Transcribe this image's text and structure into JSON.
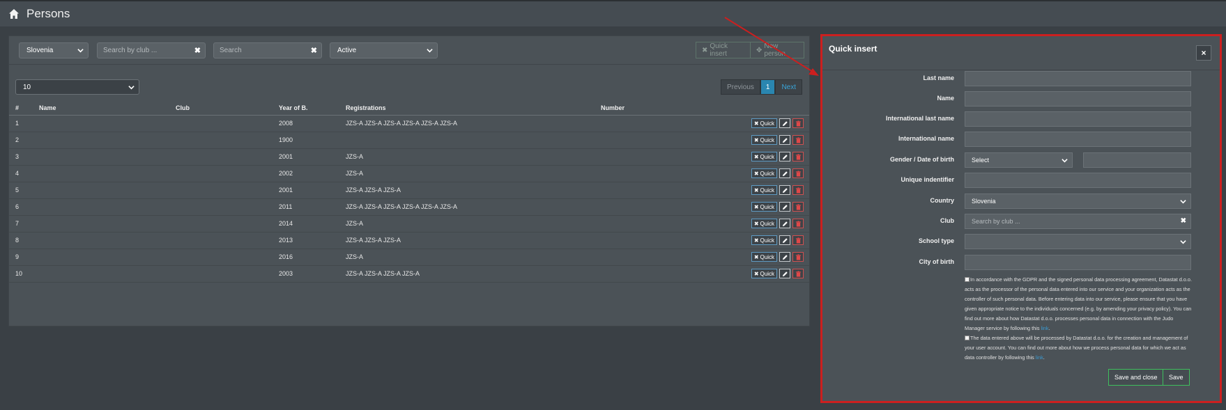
{
  "header": {
    "title": "Persons",
    "icon": "home-icon"
  },
  "filters": {
    "country": "Slovenia",
    "club_placeholder": "Search by club ...",
    "search_placeholder": "Search",
    "status": "Active",
    "quick_insert_label": "Quick insert",
    "new_person_label": "New person"
  },
  "pagination": {
    "page_size": "10",
    "previous": "Previous",
    "current": "1",
    "next": "Next"
  },
  "table": {
    "headers": [
      "#",
      "Name",
      "Club",
      "Year of B.",
      "Registrations",
      "Number"
    ],
    "quick_label": "Quick",
    "rows": [
      {
        "num": "1",
        "name": "",
        "club": "",
        "year": "2008",
        "registrations": "JZS-A JZS-A JZS-A JZS-A JZS-A JZS-A",
        "number": ""
      },
      {
        "num": "2",
        "name": "",
        "club": "",
        "year": "1900",
        "registrations": "",
        "number": ""
      },
      {
        "num": "3",
        "name": "",
        "club": "",
        "year": "2001",
        "registrations": "JZS-A",
        "number": ""
      },
      {
        "num": "4",
        "name": "",
        "club": "",
        "year": "2002",
        "registrations": "JZS-A",
        "number": ""
      },
      {
        "num": "5",
        "name": "",
        "club": "",
        "year": "2001",
        "registrations": "JZS-A JZS-A JZS-A",
        "number": ""
      },
      {
        "num": "6",
        "name": "",
        "club": "",
        "year": "2011",
        "registrations": "JZS-A JZS-A JZS-A JZS-A JZS-A JZS-A",
        "number": ""
      },
      {
        "num": "7",
        "name": "",
        "club": "",
        "year": "2014",
        "registrations": "JZS-A",
        "number": ""
      },
      {
        "num": "8",
        "name": "",
        "club": "",
        "year": "2013",
        "registrations": "JZS-A JZS-A JZS-A",
        "number": ""
      },
      {
        "num": "9",
        "name": "",
        "club": "",
        "year": "2016",
        "registrations": "JZS-A",
        "number": ""
      },
      {
        "num": "10",
        "name": "",
        "club": "",
        "year": "2003",
        "registrations": "JZS-A JZS-A JZS-A JZS-A",
        "number": ""
      }
    ]
  },
  "modal": {
    "title": "Quick insert",
    "close": "×",
    "fields": {
      "last_name": "Last name",
      "name": "Name",
      "intl_last_name": "International last name",
      "intl_name": "International name",
      "gender_dob": "Gender / Date of birth",
      "gender_value": "Select",
      "unique_id": "Unique indentifier",
      "country": "Country",
      "country_value": "Slovenia",
      "club": "Club",
      "club_placeholder": "Search by club ...",
      "school_type": "School type",
      "city_of_birth": "City of birth"
    },
    "consent1": "In accordance with the GDPR and the signed personal data processing agreement, Datastat d.o.o. acts as the processor of the personal data entered into our service and your organization acts as the controller of such personal data. Before entering data into our service, please ensure that you have given appropriate notice to the individuals concerned (e.g. by amending your privacy policy). You can find out more about how Datastat d.o.o. processes personal data in connection with the Judo Manager service by following this",
    "consent2": "The data entered above will be processed by Datastat d.o.o. for the creation and management of your user account. You can find out more about how we process personal data for which we act as data controller by following this",
    "link_label": "link",
    "save_close": "Save and close",
    "save": "Save"
  },
  "colors": {
    "accent": "#2a86b0",
    "annotation": "#cc1f1f",
    "success": "#3fbf5e"
  }
}
